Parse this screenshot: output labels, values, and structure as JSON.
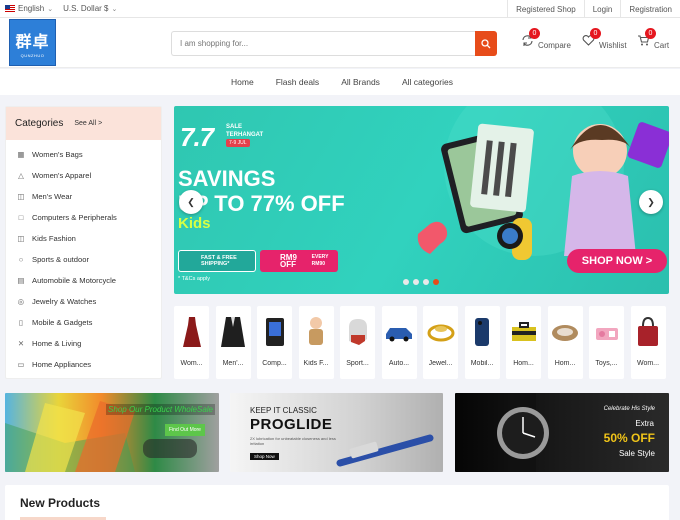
{
  "topbar": {
    "language": "English",
    "currency": "U.S. Dollar $",
    "links": [
      "Registered Shop",
      "Login",
      "Registration"
    ]
  },
  "header": {
    "logo_text": "群卓",
    "logo_subtext": "QUNZHUO",
    "search_placeholder": "I am shopping for...",
    "compare": {
      "label": "Compare",
      "count": "0"
    },
    "wishlist": {
      "label": "Wishlist",
      "count": "0"
    },
    "cart": {
      "label": "Cart",
      "count": "0"
    }
  },
  "nav": [
    "Home",
    "Flash deals",
    "All Brands",
    "All categories"
  ],
  "categories": {
    "title": "Categories",
    "see_all": "See All >",
    "items": [
      {
        "label": "Women's Bags",
        "icon": "bag-icon"
      },
      {
        "label": "Women's Apparel",
        "icon": "dress-icon"
      },
      {
        "label": "Men's Wear",
        "icon": "shirt-icon"
      },
      {
        "label": "Computers & Peripherals",
        "icon": "monitor-icon"
      },
      {
        "label": "Kids Fashion",
        "icon": "kids-shirt-icon"
      },
      {
        "label": "Sports & outdoor",
        "icon": "ball-icon"
      },
      {
        "label": "Automobile & Motorcycle",
        "icon": "car-icon"
      },
      {
        "label": "Jewelry & Watches",
        "icon": "ring-icon"
      },
      {
        "label": "Mobile & Gadgets",
        "icon": "phone-icon"
      },
      {
        "label": "Home & Living",
        "icon": "tools-icon"
      },
      {
        "label": "Home Appliances",
        "icon": "tv-icon"
      }
    ]
  },
  "banner": {
    "big": "7.7",
    "sale_line1": "SALE",
    "sale_line2": "TERHANGAT",
    "date": "7-9 JUL",
    "line1": "SAVINGS",
    "line2": "UP TO 77% OFF",
    "kids": "Kids",
    "free_shipping": "FAST & FREE SHIPPING*",
    "rm9": "RM9 OFF",
    "rm9_sub": "EVERY RM90",
    "tc": "* T&Cs apply",
    "shop_now": "SHOP NOW >",
    "slide_count": 4,
    "active_slide": 4
  },
  "tiles": [
    {
      "label": "Wom...",
      "icon": "dress-icon",
      "color": "#8b1a1a"
    },
    {
      "label": "Men'...",
      "icon": "suit-icon",
      "color": "#1f1f1f"
    },
    {
      "label": "Comp...",
      "icon": "pc-case-icon",
      "color": "#222"
    },
    {
      "label": "Kids F...",
      "icon": "kid-icon",
      "color": "#c79a60"
    },
    {
      "label": "Sport...",
      "icon": "glove-icon",
      "color": "#c0392b"
    },
    {
      "label": "Auto...",
      "icon": "car-icon",
      "color": "#2a5db0"
    },
    {
      "label": "Jewel...",
      "icon": "ring-icon",
      "color": "#d4a017"
    },
    {
      "label": "Mobil...",
      "icon": "phone-icon",
      "color": "#1b3a6b"
    },
    {
      "label": "Hom...",
      "icon": "toolbox-icon",
      "color": "#d9c21f"
    },
    {
      "label": "Hom...",
      "icon": "bed-icon",
      "color": "#b08b5e"
    },
    {
      "label": "Toys,...",
      "icon": "toy-icon",
      "color": "#e57aa0"
    },
    {
      "label": "Wom...",
      "icon": "handbag-icon",
      "color": "#a8222a"
    }
  ],
  "promos": {
    "p1": {
      "title": "Shop Our Product WholeSale",
      "button": "Find Out More"
    },
    "p2": {
      "kicker": "KEEP IT CLASSIC",
      "title": "PROGLIDE",
      "desc": "2X lubrication for unbeatable closeness and less irritation",
      "button": "Shop Now"
    },
    "p3": {
      "celebrate": "Celebrate His Style",
      "extra": "Extra",
      "offer": "50% OFF",
      "sale": "Sale Style"
    }
  },
  "new_products": {
    "title": "New Products"
  }
}
